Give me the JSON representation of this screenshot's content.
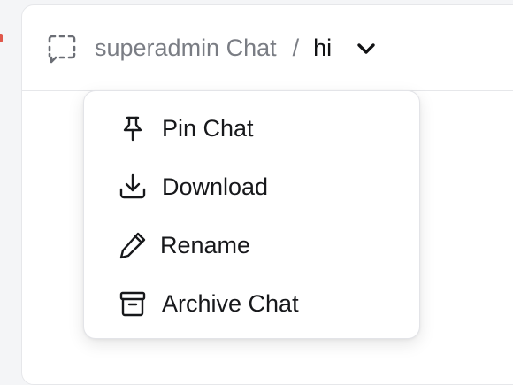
{
  "header": {
    "icon": "dashed-chat-icon",
    "breadcrumb_parent": "superadmin Chat",
    "breadcrumb_separator": "/",
    "breadcrumb_current": "hi",
    "dropdown_icon": "chevron-down-icon"
  },
  "menu": {
    "items": [
      {
        "label": "Pin Chat",
        "icon": "pin-icon"
      },
      {
        "label": "Download",
        "icon": "download-icon"
      },
      {
        "label": "Rename",
        "icon": "pencil-icon"
      },
      {
        "label": "Archive Chat",
        "icon": "archive-icon"
      }
    ]
  },
  "colors": {
    "accent_left": "#e0584b",
    "text_primary": "#111214",
    "text_muted": "#7a7d84",
    "border": "#e6e7ea"
  }
}
